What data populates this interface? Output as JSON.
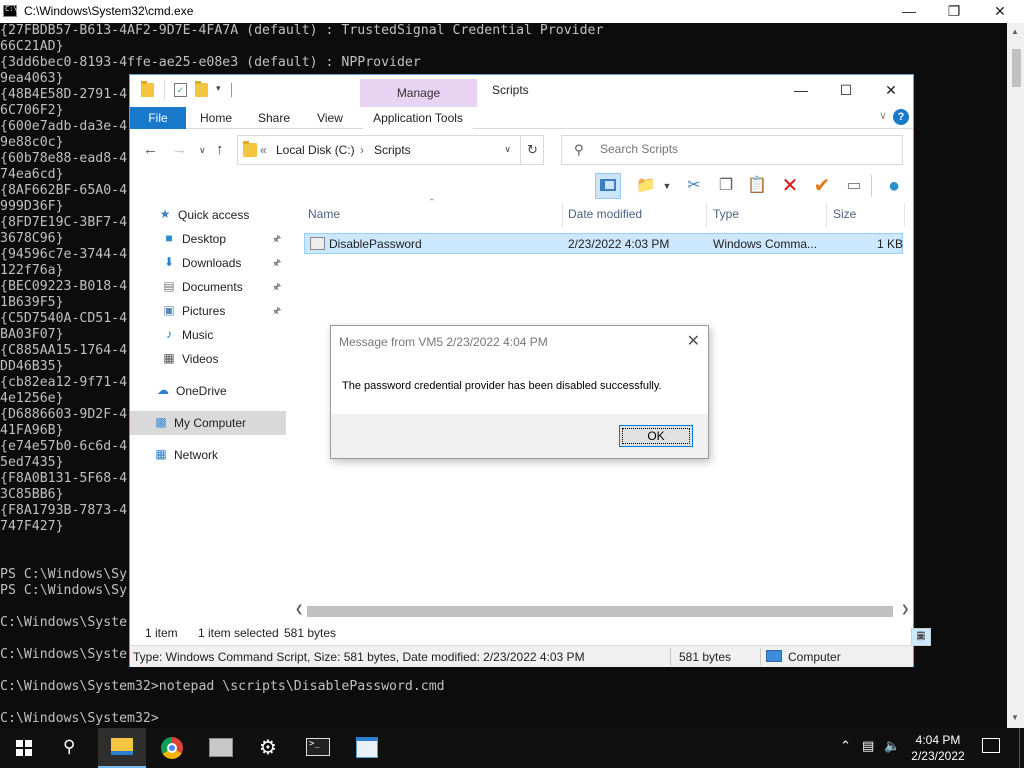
{
  "cmd": {
    "title": "C:\\Windows\\System32\\cmd.exe",
    "lines": [
      "{27FBDB57-B613-4AF2-9D7E-4FA7A (default) : TrustedSignal Credential Provider",
      "66C21AD}",
      "{3dd6bec0-8193-4ffe-ae25-e08e3 (default) : NPProvider",
      "9ea4063}",
      "{48B4E58D-2791-4",
      "6C706F2}",
      "{600e7adb-da3e-4",
      "9e88c0c}",
      "{60b78e88-ead8-4",
      "74ea6cd}",
      "{8AF662BF-65A0-4",
      "999D36F}",
      "{8FD7E19C-3BF7-4",
      "3678C96}",
      "{94596c7e-3744-4",
      "122f76a}",
      "{BEC09223-B018-4",
      "1B639F5}",
      "{C5D7540A-CD51-4",
      "BA03F07}",
      "{C885AA15-1764-4",
      "DD46B35}",
      "{cb82ea12-9f71-4",
      "4e1256e}",
      "{D6886603-9D2F-4",
      "41FA96B}",
      "{e74e57b0-6c6d-4",
      "5ed7435}",
      "{F8A0B131-5F68-4",
      "3C85BB6}",
      "{F8A1793B-7873-4",
      "747F427}",
      "",
      "",
      "PS C:\\Windows\\Sy",
      "PS C:\\Windows\\Sy",
      "",
      "C:\\Windows\\Syste",
      "",
      "C:\\Windows\\Syste",
      "",
      "C:\\Windows\\System32>notepad \\scripts\\DisablePassword.cmd",
      "",
      "C:\\Windows\\System32>"
    ]
  },
  "explorer": {
    "title": "Scripts",
    "context_tab": "Manage",
    "tabs": [
      "File",
      "Home",
      "Share",
      "View",
      "Application Tools"
    ],
    "help": "?",
    "address": {
      "crumbs": [
        "Local Disk (C:)",
        "Scripts"
      ],
      "prefix": "«"
    },
    "search_placeholder": "Search Scripts",
    "nav": [
      {
        "label": "Quick access",
        "icon": "star-icon"
      },
      {
        "label": "Desktop",
        "icon": "desktop-icon",
        "pinned": true
      },
      {
        "label": "Downloads",
        "icon": "downloads-icon",
        "pinned": true
      },
      {
        "label": "Documents",
        "icon": "documents-icon",
        "pinned": true
      },
      {
        "label": "Pictures",
        "icon": "pictures-icon",
        "pinned": true
      },
      {
        "label": "Music",
        "icon": "music-icon"
      },
      {
        "label": "Videos",
        "icon": "videos-icon"
      },
      {
        "label": "OneDrive",
        "icon": "cloud-icon"
      },
      {
        "label": "My Computer",
        "icon": "computer-icon",
        "selected": true
      },
      {
        "label": "Network",
        "icon": "network-icon"
      }
    ],
    "columns": [
      "Name",
      "Date modified",
      "Type",
      "Size"
    ],
    "files": [
      {
        "name": "DisablePassword",
        "date": "2/23/2022 4:03 PM",
        "type": "Windows Comma...",
        "size": "1 KB"
      }
    ],
    "status": {
      "count": "1 item",
      "selected": "1 item selected",
      "bytes": "581 bytes"
    },
    "details_bar": {
      "text": "Type: Windows Command Script, Size: 581 bytes, Date modified: 2/23/2022 4:03 PM",
      "size": "581 bytes",
      "location": "Computer"
    }
  },
  "message": {
    "title": "Message from VM5 2/23/2022 4:04 PM",
    "body": "The password credential provider has been disabled successfully.",
    "ok": "OK"
  },
  "taskbar": {
    "time": "4:04 PM",
    "date": "2/23/2022",
    "apps": [
      "file-explorer-icon",
      "chrome-icon",
      "server-manager-icon",
      "settings-icon",
      "powershell-icon",
      "notepad-icon"
    ]
  },
  "colors": {
    "accent": "#1979ca",
    "manage_tab": "#e8d3f2",
    "selection": "#cce8ff",
    "taskbar": "#101010"
  }
}
